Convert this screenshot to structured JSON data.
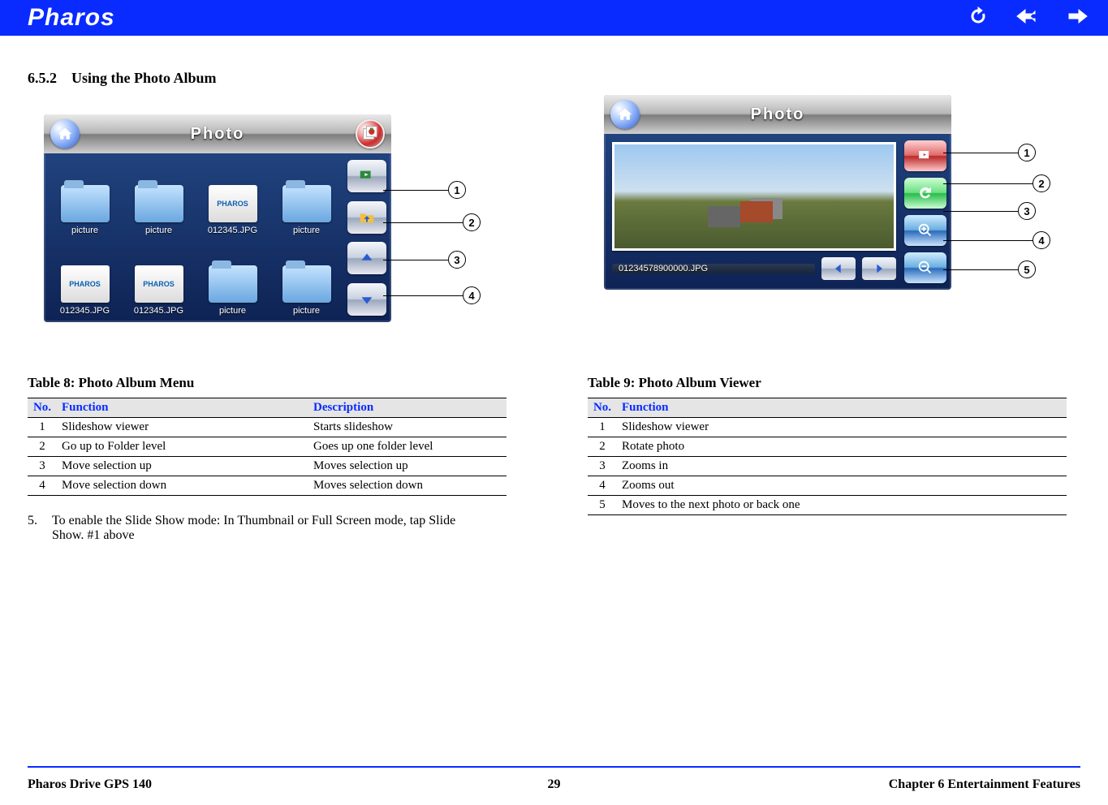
{
  "header": {
    "brand": "Pharos",
    "icons": [
      "refresh-icon",
      "back-icon",
      "forward-icon"
    ]
  },
  "section": {
    "number": "6.5.2",
    "title": "Using the Photo Album"
  },
  "screenshot_left": {
    "title": "Photo",
    "tiles": [
      {
        "type": "folder",
        "label": "picture"
      },
      {
        "type": "folder",
        "label": "picture"
      },
      {
        "type": "thumb",
        "label": "012345.JPG"
      },
      {
        "type": "folder",
        "label": "picture"
      },
      {
        "type": "thumb",
        "label": "012345.JPG"
      },
      {
        "type": "thumb",
        "label": "012345.JPG"
      },
      {
        "type": "folder",
        "label": "picture"
      },
      {
        "type": "folder",
        "label": "picture"
      }
    ],
    "callouts": [
      "1",
      "2",
      "3",
      "4"
    ]
  },
  "screenshot_right": {
    "title": "Photo",
    "filename": "01234578900000.JPG",
    "callouts": [
      "1",
      "2",
      "3",
      "4",
      "5"
    ]
  },
  "table8": {
    "caption": "Table 8: Photo Album Menu",
    "headers": {
      "no": "No.",
      "func": "Function",
      "desc": "Description"
    },
    "rows": [
      {
        "no": "1",
        "func": "Slideshow viewer",
        "desc": "Starts slideshow"
      },
      {
        "no": "2",
        "func": "Go up to Folder level",
        "desc": "Goes up one folder level"
      },
      {
        "no": "3",
        "func": "Move selection up",
        "desc": "Moves selection up"
      },
      {
        "no": "4",
        "func": "Move selection down",
        "desc": "Moves selection down"
      }
    ]
  },
  "table9": {
    "caption": "Table 9: Photo Album Viewer",
    "headers": {
      "no": "No.",
      "func": "Function"
    },
    "rows": [
      {
        "no": "1",
        "func": "Slideshow viewer"
      },
      {
        "no": "2",
        "func": "Rotate photo"
      },
      {
        "no": "3",
        "func": "Zooms in"
      },
      {
        "no": "4",
        "func": "Zooms out"
      },
      {
        "no": "5",
        "func": "Moves to the next photo or back one"
      }
    ]
  },
  "note": {
    "num": "5.",
    "text": "To enable the Slide Show mode: In Thumbnail or Full Screen mode, tap Slide Show. #1 above"
  },
  "footer": {
    "left": "Pharos Drive GPS 140",
    "center": "29",
    "right": "Chapter 6 Entertainment Features"
  }
}
